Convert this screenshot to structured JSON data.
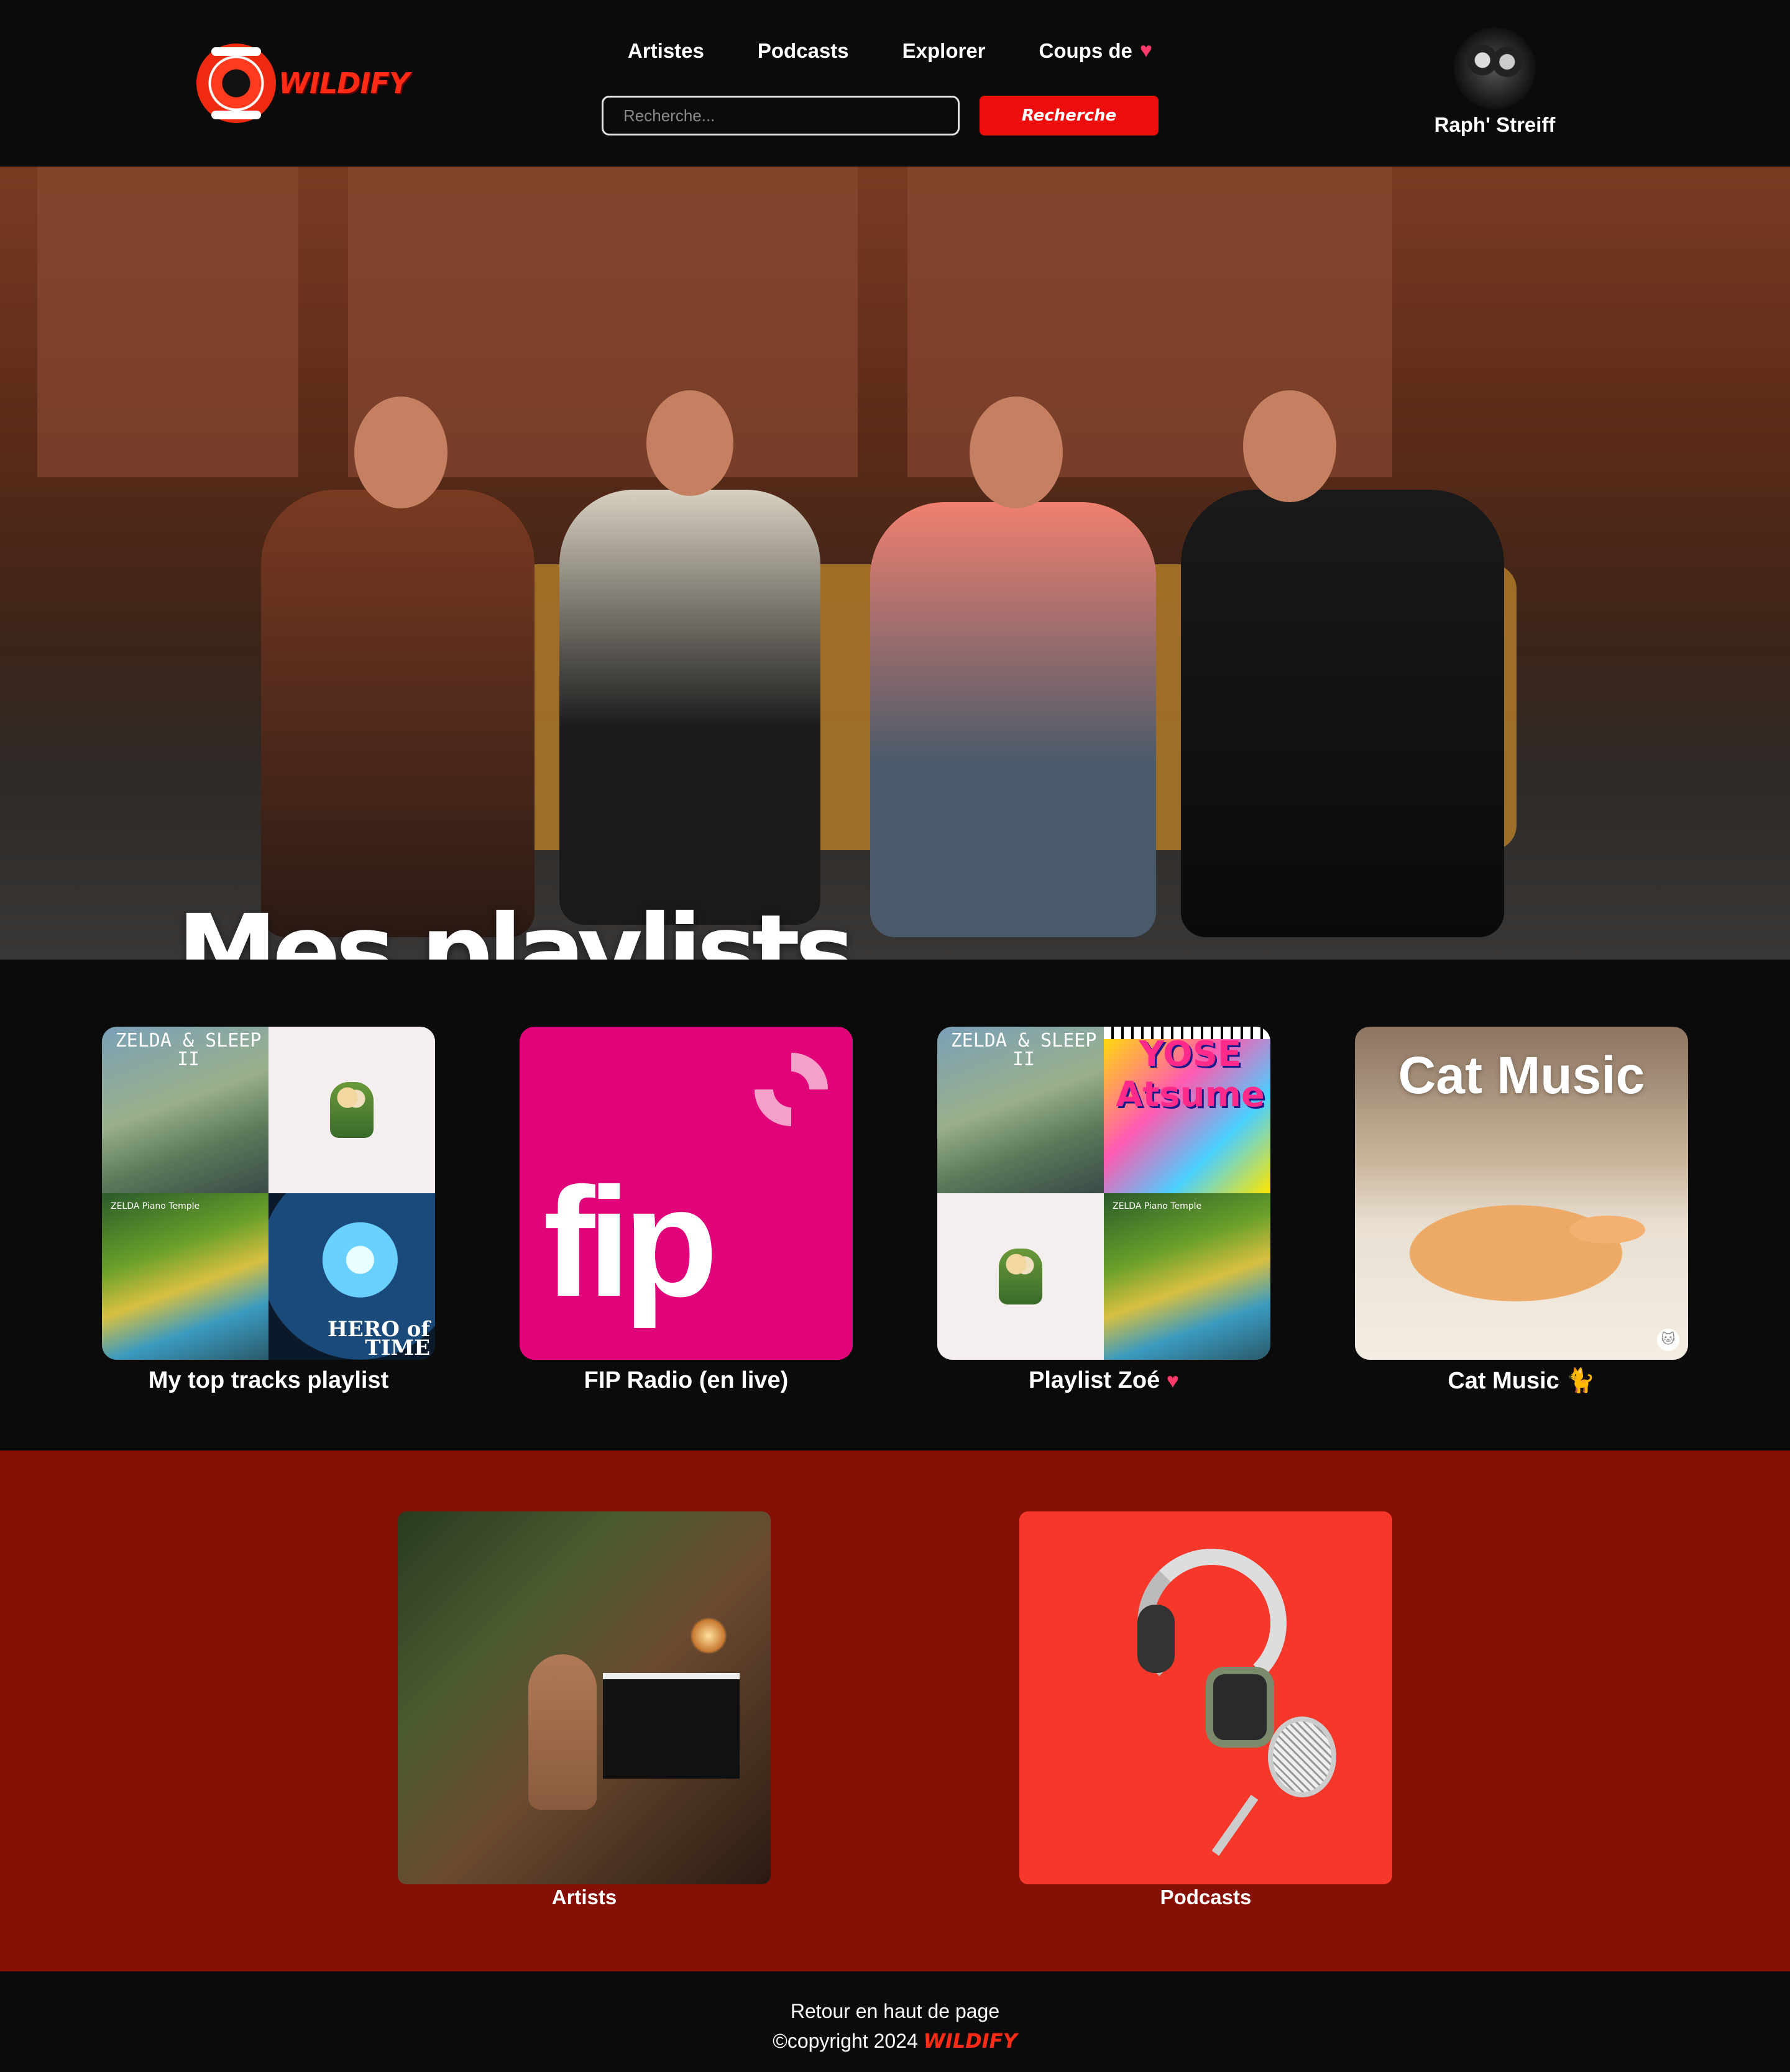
{
  "header": {
    "logo_text": "WILDIFY",
    "nav": [
      {
        "label": "Artistes"
      },
      {
        "label": "Podcasts"
      },
      {
        "label": "Explorer"
      },
      {
        "label": "Coups de",
        "icon": "heart-icon"
      }
    ],
    "search": {
      "placeholder": "Recherche...",
      "value": "",
      "button_label": "Recherche"
    },
    "user": {
      "name": "Raph' Streiff"
    }
  },
  "hero": {
    "title": "Mes playlists"
  },
  "playlists": [
    {
      "label": "My top tracks playlist",
      "cover_texts": [
        "ZELDA & SLEEP II",
        "ZELDA Piano Temple",
        "HERO of TIME"
      ]
    },
    {
      "label": "FIP Radio (en live)",
      "cover_texts": [
        "fip"
      ]
    },
    {
      "label": "Playlist Zoé",
      "label_icon": "heart-icon",
      "cover_texts": [
        "ZELDA & SLEEP II",
        "YOSE Atsume",
        "ZELDA Piano Temple"
      ]
    },
    {
      "label": "Cat Music",
      "label_icon": "cat-icon",
      "cover_texts": [
        "Cat Music"
      ]
    }
  ],
  "categories": [
    {
      "label": "Artists"
    },
    {
      "label": "Podcasts"
    }
  ],
  "footer": {
    "back_to_top": "Retour en haut de page",
    "copyright": "©copyright 2024",
    "brand": "WILDIFY"
  },
  "colors": {
    "accent": "#ee0d0d",
    "background": "#0b0b0b",
    "categories_bg": "#861006",
    "fip_pink": "#e0037a"
  }
}
